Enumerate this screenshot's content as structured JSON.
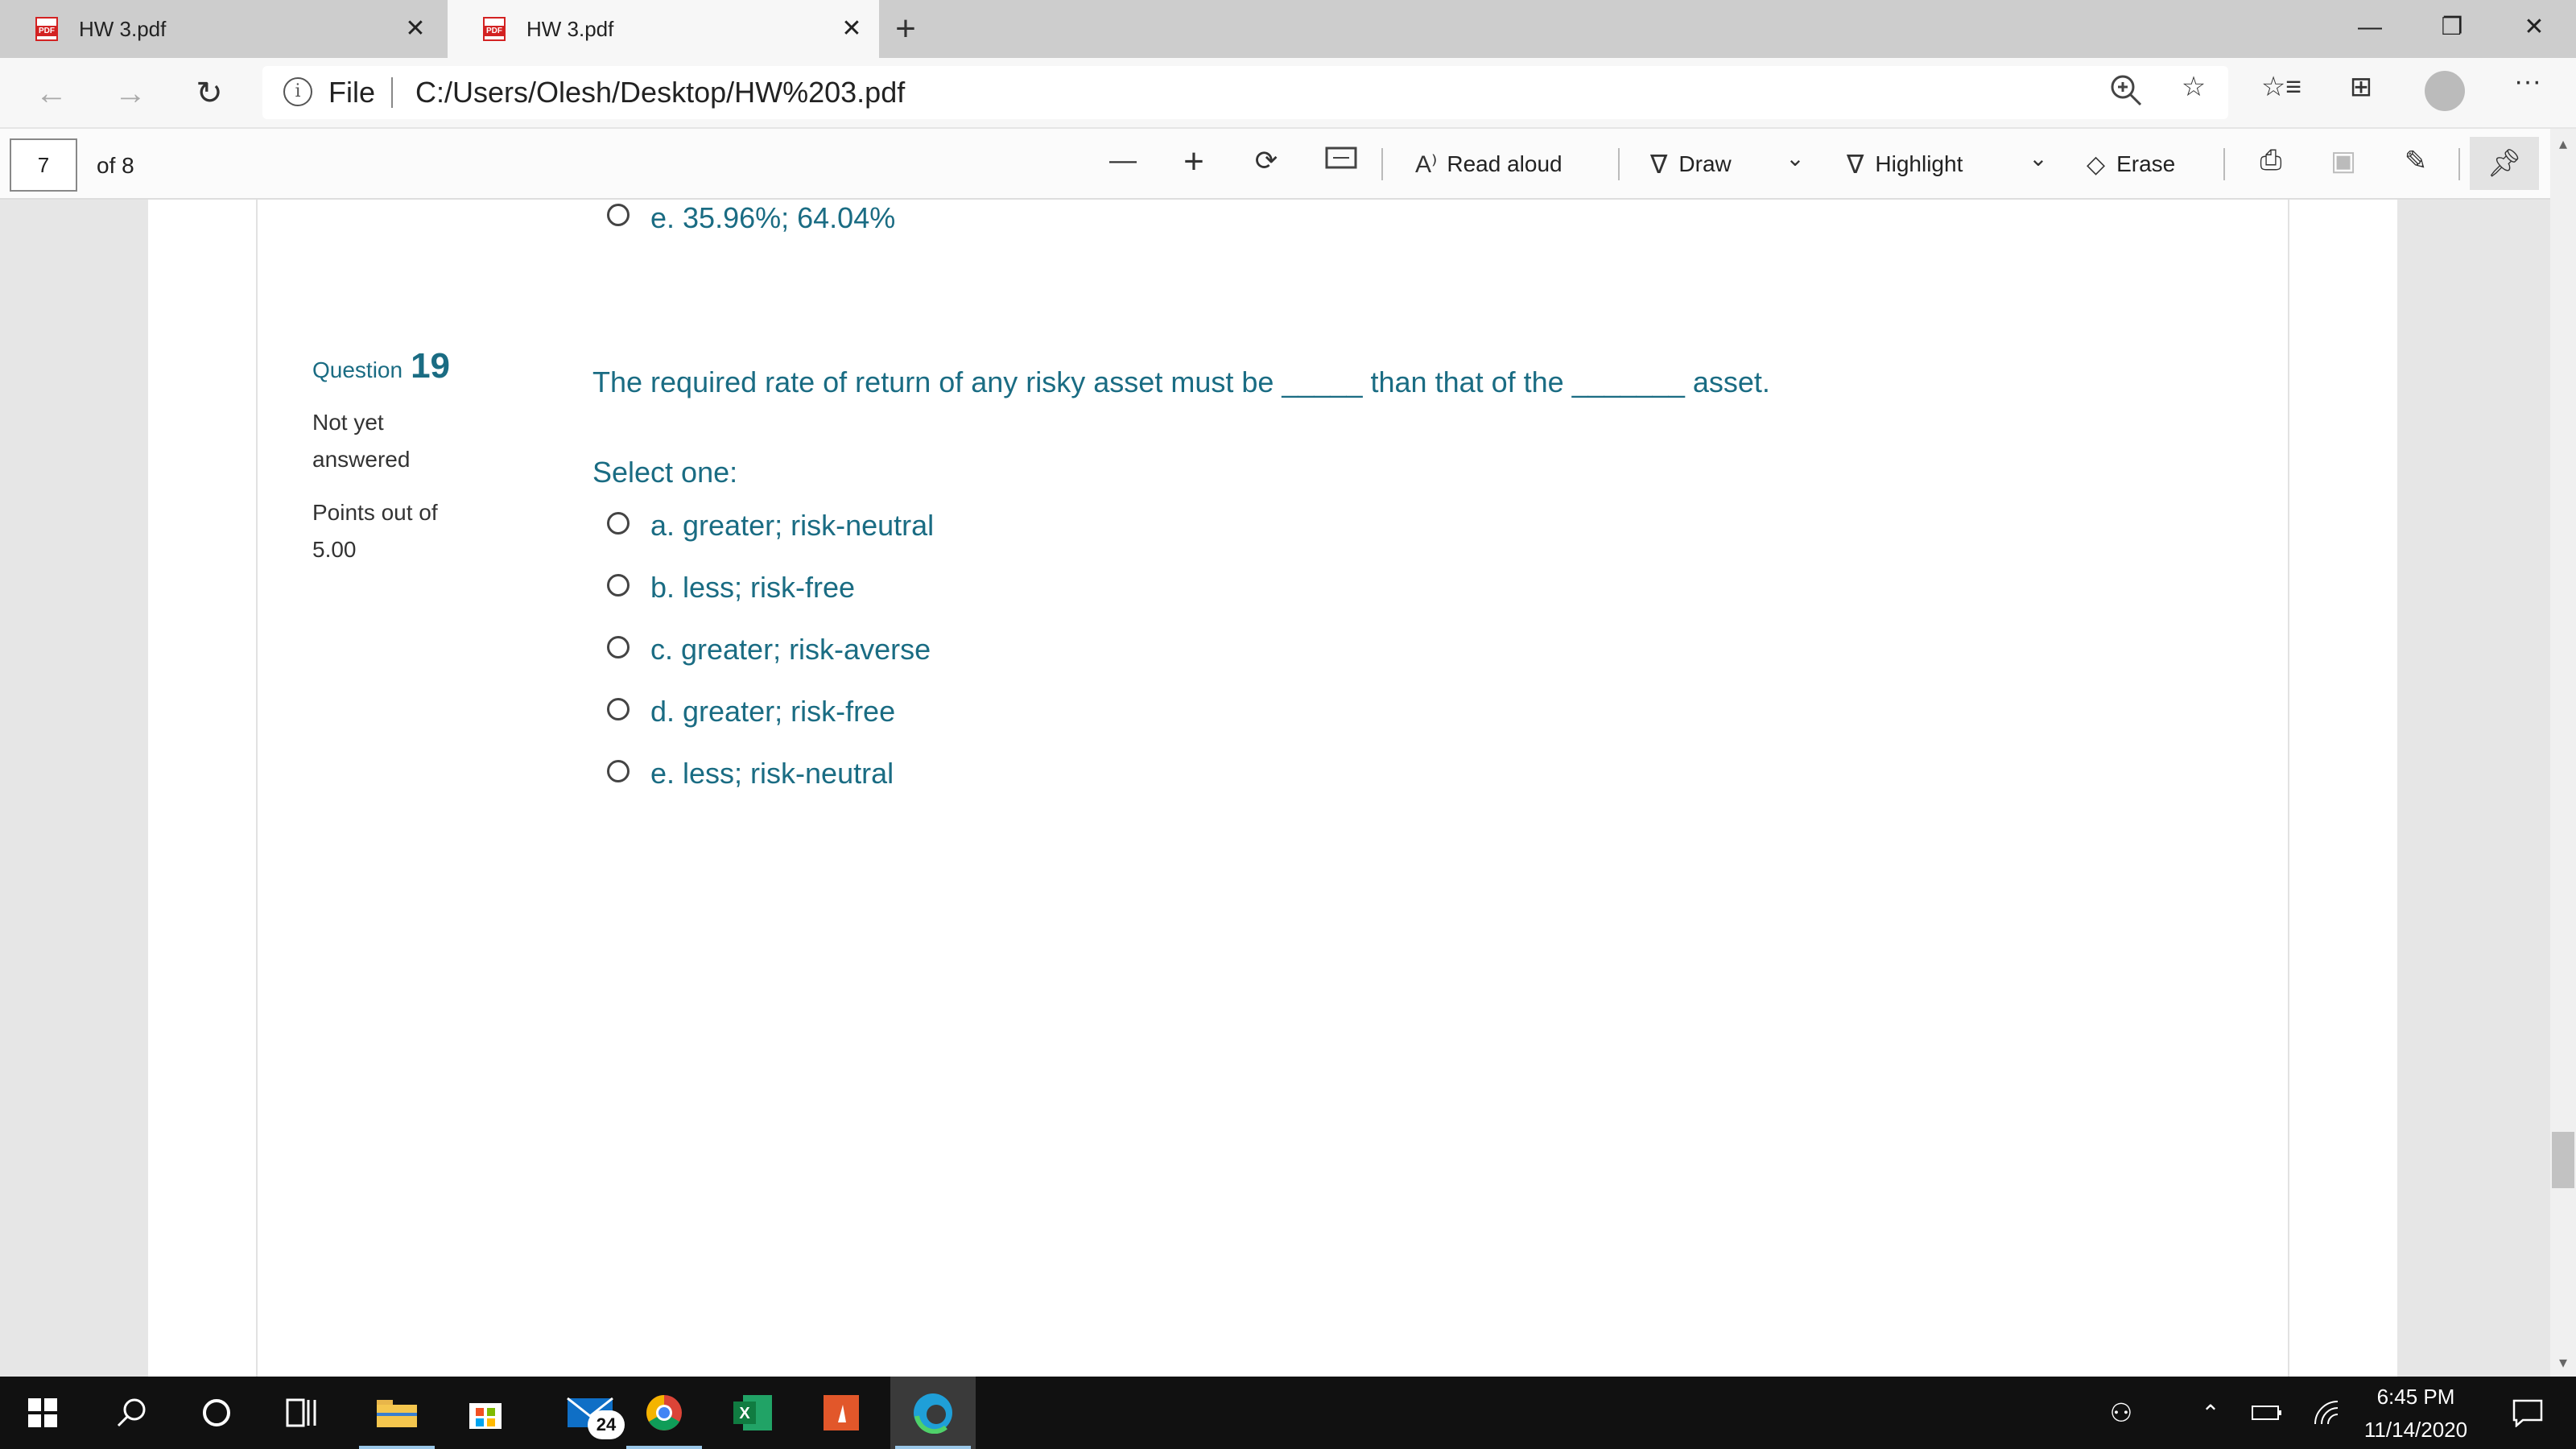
{
  "browser": {
    "tabs": [
      {
        "title": "HW 3.pdf",
        "active": false
      },
      {
        "title": "HW 3.pdf",
        "active": true
      }
    ],
    "address": {
      "scheme_label": "File",
      "url": "C:/Users/Olesh/Desktop/HW%203.pdf"
    }
  },
  "pdf_toolbar": {
    "page_current": "7",
    "page_total": "of 8",
    "read_aloud_label": "Read aloud",
    "draw_label": "Draw",
    "highlight_label": "Highlight",
    "erase_label": "Erase"
  },
  "document": {
    "prev_option": "e. 35.96%; 64.04%",
    "question": {
      "label": "Question",
      "number": "19",
      "status_line1": "Not yet",
      "status_line2": "answered",
      "points_line1": "Points out of",
      "points_line2": "5.00",
      "text": "The required rate of return of any risky asset must be _____ than that of the _______ asset.",
      "select_prompt": "Select one:",
      "options": [
        "a. greater; risk-neutral",
        "b. less; risk-free",
        "c. greater; risk-averse",
        "d. greater; risk-free",
        "e. less; risk-neutral"
      ]
    }
  },
  "taskbar": {
    "mail_badge": "24",
    "time": "6:45 PM",
    "date": "11/14/2020"
  },
  "colors": {
    "accent_teal": "#1a6c83",
    "pdf_red": "#d32222",
    "taskbar_bg": "#111111"
  }
}
